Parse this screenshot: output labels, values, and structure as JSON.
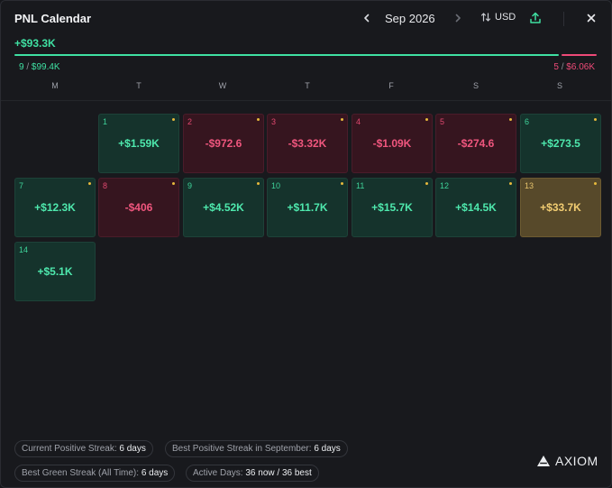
{
  "header": {
    "title": "PNL Calendar",
    "month": "Sep 2026",
    "currency": "USD"
  },
  "summary": {
    "total": "+$93.3K",
    "win_days": "9",
    "win_amount": "$99.4K",
    "loss_days": "5",
    "loss_amount": "$6.06K",
    "win_fraction": 0.94
  },
  "weekdays": [
    "M",
    "T",
    "W",
    "T",
    "F",
    "S",
    "S"
  ],
  "days": [
    {
      "day": "1",
      "value": "+$1.59K",
      "type": "pos"
    },
    {
      "day": "2",
      "value": "-$972.6",
      "type": "neg"
    },
    {
      "day": "3",
      "value": "-$3.32K",
      "type": "neg"
    },
    {
      "day": "4",
      "value": "-$1.09K",
      "type": "neg"
    },
    {
      "day": "5",
      "value": "-$274.6",
      "type": "neg"
    },
    {
      "day": "6",
      "value": "+$273.5",
      "type": "pos"
    },
    {
      "day": "7",
      "value": "+$12.3K",
      "type": "pos"
    },
    {
      "day": "8",
      "value": "-$406",
      "type": "neg"
    },
    {
      "day": "9",
      "value": "+$4.52K",
      "type": "pos"
    },
    {
      "day": "10",
      "value": "+$11.7K",
      "type": "pos"
    },
    {
      "day": "11",
      "value": "+$15.7K",
      "type": "pos"
    },
    {
      "day": "12",
      "value": "+$14.5K",
      "type": "pos"
    },
    {
      "day": "13",
      "value": "+$33.7K",
      "type": "best"
    },
    {
      "day": "14",
      "value": "+$5.1K",
      "type": "pos"
    }
  ],
  "streaks": {
    "current_positive_label": "Current Positive Streak:",
    "current_positive_value": "6 days",
    "best_positive_label": "Best Positive Streak in September:",
    "best_positive_value": "6 days",
    "best_green_label": "Best Green Streak (All Time):",
    "best_green_value": "6 days",
    "active_label": "Active Days:",
    "active_value": "36 now / 36 best"
  },
  "brand": "AXIOM",
  "colors": {
    "positive": "#4ee8ad",
    "negative": "#f0567e",
    "best": "#f2cd72",
    "background": "#18191d"
  },
  "icons": [
    "chevron-left-icon",
    "chevron-right-icon",
    "sort-arrows-icon",
    "share-upload-icon",
    "close-icon",
    "axiom-logo-icon"
  ]
}
